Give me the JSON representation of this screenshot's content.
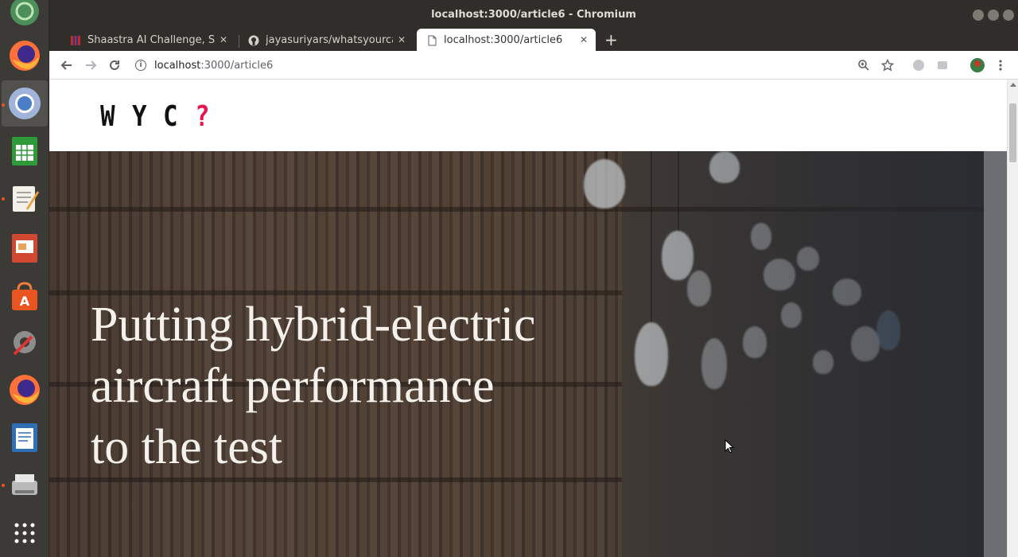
{
  "window": {
    "title": "localhost:3000/article6 - Chromium"
  },
  "tabs": [
    {
      "label": "Shaastra AI Challenge, Sh",
      "icon": "shaastra-icon"
    },
    {
      "label": "jayasuriyars/whatsyourca",
      "icon": "github-icon"
    },
    {
      "label": "localhost:3000/article6",
      "icon": "page-icon"
    }
  ],
  "toolbar": {
    "url_host": "localhost",
    "url_path": ":3000/article6"
  },
  "site": {
    "logo": [
      "W",
      "Y",
      "C"
    ],
    "logo_mark": "?",
    "hero_title_lines": [
      "Putting hybrid-electric",
      "aircraft performance",
      "to the test"
    ]
  },
  "colors": {
    "accent": "#e8124f",
    "chrome_dark": "#2f2e2b",
    "launcher": "#3b3a36"
  }
}
